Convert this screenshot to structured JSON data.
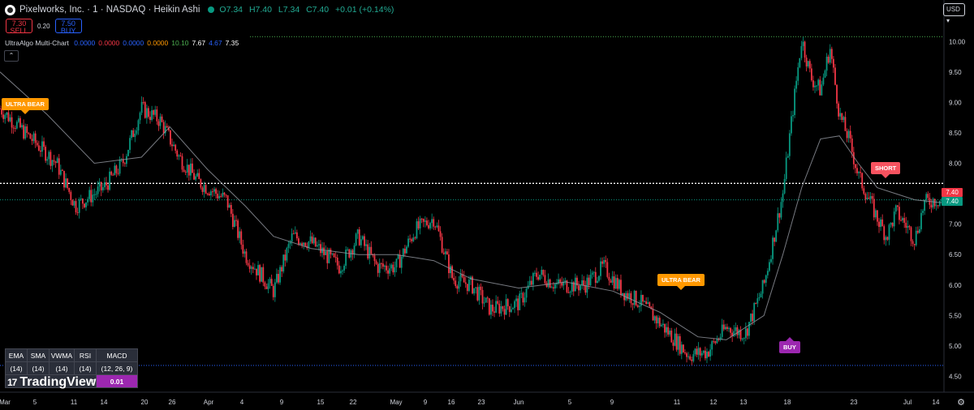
{
  "header": {
    "title": "Pixelworks, Inc. · 1 · NASDAQ · Heikin Ashi",
    "open": "O7.34",
    "high": "H7.40",
    "low": "L7.34",
    "close": "C7.40",
    "change": "+0.01 (+0.14%)"
  },
  "trade": {
    "sell_price": "7.30",
    "sell_label": "SELL",
    "spread": "0.20",
    "buy_price": "7.50",
    "buy_label": "BUY"
  },
  "indicator": {
    "name": "UltraAlgo Multi-Chart",
    "values": [
      {
        "text": "0.0000",
        "color": "#2962ff"
      },
      {
        "text": "0.0000",
        "color": "#f23645"
      },
      {
        "text": "0.0000",
        "color": "#2962ff"
      },
      {
        "text": "0.0000",
        "color": "#ff9800"
      },
      {
        "text": "10.10",
        "color": "#4caf50"
      },
      {
        "text": "7.67",
        "color": "#ffffff"
      },
      {
        "text": "4.67",
        "color": "#2962ff"
      },
      {
        "text": "7.35",
        "color": "#ffffff"
      }
    ]
  },
  "currency": "USD",
  "signals": {
    "ultra_bear_1": "ULTRA BEAR",
    "ultra_bear_2": "ULTRA BEAR",
    "short": "SHORT",
    "buy": "BUY"
  },
  "price_tags": {
    "upper": "7.40",
    "lower": "7.40"
  },
  "stats_table": {
    "headers": [
      "EMA",
      "SMA",
      "VWMA",
      "RSI",
      "MACD"
    ],
    "params": [
      "(14)",
      "(14)",
      "(14)",
      "(14)",
      "(12, 26, 9)"
    ],
    "partial_value": "7",
    "macd_value": "0.01"
  },
  "branding": "TradingView",
  "colors": {
    "up": "#089981",
    "down": "#f23645",
    "level_green": "#4caf50",
    "level_blue": "#2962ff",
    "ma": "#9598a1"
  },
  "chart_data": {
    "type": "candlestick",
    "style": "Heikin Ashi",
    "y_axis": {
      "ticks": [
        "10.00",
        "9.50",
        "9.00",
        "8.50",
        "8.00",
        "7.50",
        "7.00",
        "6.50",
        "6.00",
        "5.50",
        "5.00",
        "4.50"
      ],
      "ylim": [
        4.4,
        10.15
      ]
    },
    "x_axis": {
      "ticks": [
        "Mar",
        "5",
        "11",
        "14",
        "20",
        "26",
        "Apr",
        "4",
        "9",
        "15",
        "22",
        "May",
        "9",
        "16",
        "23",
        "Jun",
        "5",
        "9",
        "11",
        "12",
        "13",
        "18",
        "23",
        "Jul",
        "14"
      ]
    },
    "levels": [
      {
        "value": 10.08,
        "style": "dotted",
        "color": "#4caf50"
      },
      {
        "value": 7.67,
        "style": "dotted",
        "color": "#ffffff"
      },
      {
        "value": 7.4,
        "style": "dotted",
        "color": "#089981"
      },
      {
        "value": 4.68,
        "style": "dotted",
        "color": "#2962ff"
      }
    ],
    "price_path": [
      [
        0,
        8.9
      ],
      [
        0.02,
        8.6
      ],
      [
        0.06,
        8.0
      ],
      [
        0.08,
        7.3
      ],
      [
        0.11,
        7.6
      ],
      [
        0.13,
        8.0
      ],
      [
        0.15,
        8.9
      ],
      [
        0.17,
        8.7
      ],
      [
        0.19,
        8.1
      ],
      [
        0.21,
        7.7
      ],
      [
        0.24,
        7.4
      ],
      [
        0.26,
        6.5
      ],
      [
        0.29,
        5.9
      ],
      [
        0.31,
        6.8
      ],
      [
        0.33,
        6.7
      ],
      [
        0.36,
        6.3
      ],
      [
        0.38,
        6.8
      ],
      [
        0.4,
        6.3
      ],
      [
        0.42,
        6.3
      ],
      [
        0.44,
        6.9
      ],
      [
        0.46,
        7.1
      ],
      [
        0.48,
        6.1
      ],
      [
        0.5,
        6.0
      ],
      [
        0.52,
        5.6
      ],
      [
        0.55,
        5.7
      ],
      [
        0.57,
        6.2
      ],
      [
        0.59,
        6.0
      ],
      [
        0.62,
        6.0
      ],
      [
        0.64,
        6.3
      ],
      [
        0.66,
        5.9
      ],
      [
        0.68,
        5.7
      ],
      [
        0.71,
        5.2
      ],
      [
        0.73,
        4.85
      ],
      [
        0.75,
        4.9
      ],
      [
        0.77,
        5.3
      ],
      [
        0.79,
        5.2
      ],
      [
        0.81,
        6.0
      ],
      [
        0.83,
        7.5
      ],
      [
        0.84,
        8.8
      ],
      [
        0.85,
        10.05
      ],
      [
        0.86,
        9.4
      ],
      [
        0.87,
        9.2
      ],
      [
        0.88,
        9.9
      ],
      [
        0.89,
        8.8
      ],
      [
        0.9,
        8.4
      ],
      [
        0.91,
        7.8
      ],
      [
        0.93,
        7.1
      ],
      [
        0.94,
        6.8
      ],
      [
        0.95,
        7.2
      ],
      [
        0.96,
        7.0
      ],
      [
        0.97,
        6.75
      ],
      [
        0.98,
        7.35
      ],
      [
        0.99,
        7.4
      ],
      [
        1.0,
        7.4
      ]
    ],
    "ma_path": [
      [
        0,
        9.5
      ],
      [
        0.05,
        8.8
      ],
      [
        0.1,
        8.0
      ],
      [
        0.15,
        8.1
      ],
      [
        0.18,
        8.6
      ],
      [
        0.22,
        7.9
      ],
      [
        0.26,
        7.3
      ],
      [
        0.29,
        6.8
      ],
      [
        0.33,
        6.6
      ],
      [
        0.38,
        6.5
      ],
      [
        0.42,
        6.5
      ],
      [
        0.46,
        6.4
      ],
      [
        0.5,
        6.1
      ],
      [
        0.55,
        5.95
      ],
      [
        0.6,
        6.05
      ],
      [
        0.65,
        5.9
      ],
      [
        0.7,
        5.55
      ],
      [
        0.74,
        5.15
      ],
      [
        0.77,
        5.1
      ],
      [
        0.81,
        5.5
      ],
      [
        0.83,
        6.5
      ],
      [
        0.85,
        7.6
      ],
      [
        0.87,
        8.4
      ],
      [
        0.89,
        8.45
      ],
      [
        0.91,
        8.0
      ],
      [
        0.93,
        7.6
      ],
      [
        0.95,
        7.5
      ],
      [
        0.97,
        7.4
      ],
      [
        1.0,
        7.35
      ]
    ]
  }
}
